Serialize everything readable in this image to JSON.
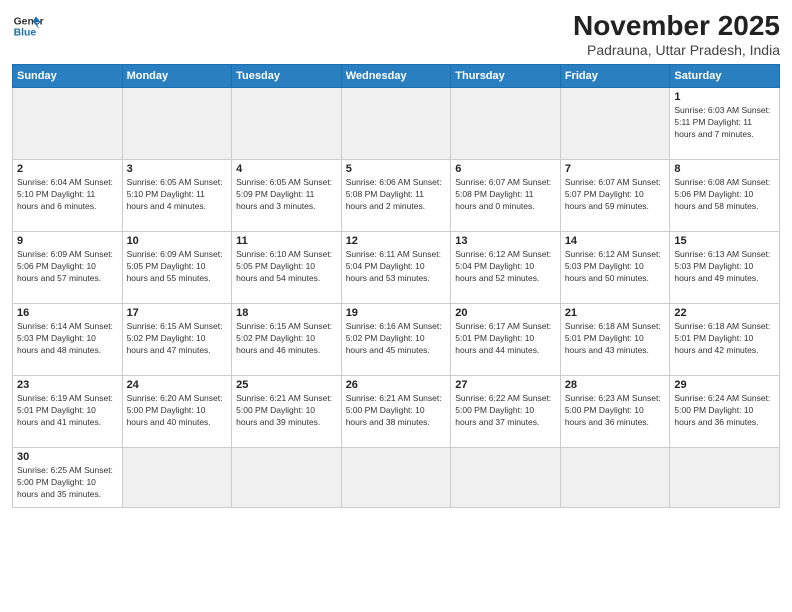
{
  "header": {
    "logo_line1": "General",
    "logo_line2": "Blue",
    "title": "November 2025",
    "subtitle": "Padrauna, Uttar Pradesh, India"
  },
  "weekdays": [
    "Sunday",
    "Monday",
    "Tuesday",
    "Wednesday",
    "Thursday",
    "Friday",
    "Saturday"
  ],
  "weeks": [
    [
      {
        "day": "",
        "info": ""
      },
      {
        "day": "",
        "info": ""
      },
      {
        "day": "",
        "info": ""
      },
      {
        "day": "",
        "info": ""
      },
      {
        "day": "",
        "info": ""
      },
      {
        "day": "",
        "info": ""
      },
      {
        "day": "1",
        "info": "Sunrise: 6:03 AM\nSunset: 5:11 PM\nDaylight: 11 hours\nand 7 minutes."
      }
    ],
    [
      {
        "day": "2",
        "info": "Sunrise: 6:04 AM\nSunset: 5:10 PM\nDaylight: 11 hours\nand 6 minutes."
      },
      {
        "day": "3",
        "info": "Sunrise: 6:05 AM\nSunset: 5:10 PM\nDaylight: 11 hours\nand 4 minutes."
      },
      {
        "day": "4",
        "info": "Sunrise: 6:05 AM\nSunset: 5:09 PM\nDaylight: 11 hours\nand 3 minutes."
      },
      {
        "day": "5",
        "info": "Sunrise: 6:06 AM\nSunset: 5:08 PM\nDaylight: 11 hours\nand 2 minutes."
      },
      {
        "day": "6",
        "info": "Sunrise: 6:07 AM\nSunset: 5:08 PM\nDaylight: 11 hours\nand 0 minutes."
      },
      {
        "day": "7",
        "info": "Sunrise: 6:07 AM\nSunset: 5:07 PM\nDaylight: 10 hours\nand 59 minutes."
      },
      {
        "day": "8",
        "info": "Sunrise: 6:08 AM\nSunset: 5:06 PM\nDaylight: 10 hours\nand 58 minutes."
      }
    ],
    [
      {
        "day": "9",
        "info": "Sunrise: 6:09 AM\nSunset: 5:06 PM\nDaylight: 10 hours\nand 57 minutes."
      },
      {
        "day": "10",
        "info": "Sunrise: 6:09 AM\nSunset: 5:05 PM\nDaylight: 10 hours\nand 55 minutes."
      },
      {
        "day": "11",
        "info": "Sunrise: 6:10 AM\nSunset: 5:05 PM\nDaylight: 10 hours\nand 54 minutes."
      },
      {
        "day": "12",
        "info": "Sunrise: 6:11 AM\nSunset: 5:04 PM\nDaylight: 10 hours\nand 53 minutes."
      },
      {
        "day": "13",
        "info": "Sunrise: 6:12 AM\nSunset: 5:04 PM\nDaylight: 10 hours\nand 52 minutes."
      },
      {
        "day": "14",
        "info": "Sunrise: 6:12 AM\nSunset: 5:03 PM\nDaylight: 10 hours\nand 50 minutes."
      },
      {
        "day": "15",
        "info": "Sunrise: 6:13 AM\nSunset: 5:03 PM\nDaylight: 10 hours\nand 49 minutes."
      }
    ],
    [
      {
        "day": "16",
        "info": "Sunrise: 6:14 AM\nSunset: 5:03 PM\nDaylight: 10 hours\nand 48 minutes."
      },
      {
        "day": "17",
        "info": "Sunrise: 6:15 AM\nSunset: 5:02 PM\nDaylight: 10 hours\nand 47 minutes."
      },
      {
        "day": "18",
        "info": "Sunrise: 6:15 AM\nSunset: 5:02 PM\nDaylight: 10 hours\nand 46 minutes."
      },
      {
        "day": "19",
        "info": "Sunrise: 6:16 AM\nSunset: 5:02 PM\nDaylight: 10 hours\nand 45 minutes."
      },
      {
        "day": "20",
        "info": "Sunrise: 6:17 AM\nSunset: 5:01 PM\nDaylight: 10 hours\nand 44 minutes."
      },
      {
        "day": "21",
        "info": "Sunrise: 6:18 AM\nSunset: 5:01 PM\nDaylight: 10 hours\nand 43 minutes."
      },
      {
        "day": "22",
        "info": "Sunrise: 6:18 AM\nSunset: 5:01 PM\nDaylight: 10 hours\nand 42 minutes."
      }
    ],
    [
      {
        "day": "23",
        "info": "Sunrise: 6:19 AM\nSunset: 5:01 PM\nDaylight: 10 hours\nand 41 minutes."
      },
      {
        "day": "24",
        "info": "Sunrise: 6:20 AM\nSunset: 5:00 PM\nDaylight: 10 hours\nand 40 minutes."
      },
      {
        "day": "25",
        "info": "Sunrise: 6:21 AM\nSunset: 5:00 PM\nDaylight: 10 hours\nand 39 minutes."
      },
      {
        "day": "26",
        "info": "Sunrise: 6:21 AM\nSunset: 5:00 PM\nDaylight: 10 hours\nand 38 minutes."
      },
      {
        "day": "27",
        "info": "Sunrise: 6:22 AM\nSunset: 5:00 PM\nDaylight: 10 hours\nand 37 minutes."
      },
      {
        "day": "28",
        "info": "Sunrise: 6:23 AM\nSunset: 5:00 PM\nDaylight: 10 hours\nand 36 minutes."
      },
      {
        "day": "29",
        "info": "Sunrise: 6:24 AM\nSunset: 5:00 PM\nDaylight: 10 hours\nand 36 minutes."
      }
    ],
    [
      {
        "day": "30",
        "info": "Sunrise: 6:25 AM\nSunset: 5:00 PM\nDaylight: 10 hours\nand 35 minutes."
      },
      {
        "day": "",
        "info": ""
      },
      {
        "day": "",
        "info": ""
      },
      {
        "day": "",
        "info": ""
      },
      {
        "day": "",
        "info": ""
      },
      {
        "day": "",
        "info": ""
      },
      {
        "day": "",
        "info": ""
      }
    ]
  ]
}
